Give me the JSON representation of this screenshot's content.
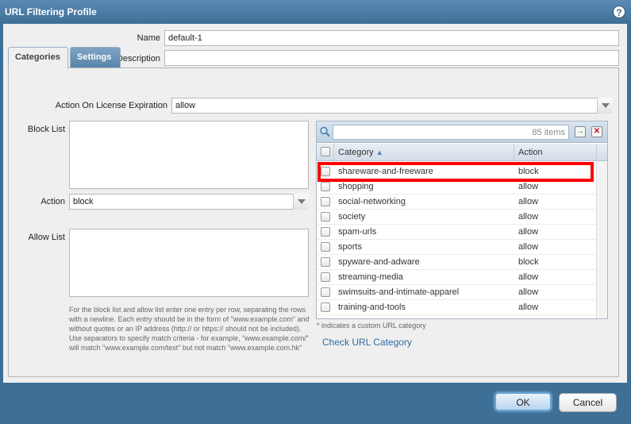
{
  "dialog": {
    "title": "URL Filtering Profile",
    "help_icon": "question-circle-icon",
    "help_glyph": "?"
  },
  "form": {
    "name_label": "Name",
    "name_value": "default-1",
    "description_label": "Description",
    "description_value": ""
  },
  "tabs": [
    {
      "label": "Categories",
      "active": true
    },
    {
      "label": "Settings",
      "active": false
    }
  ],
  "categories": {
    "license_label": "Action On License Expiration",
    "license_value": "allow",
    "block_list_label": "Block List",
    "action_label": "Action",
    "action_value": "block",
    "allow_list_label": "Allow List",
    "help_text": "For the block list and allow list enter one entry per row, separating the rows with a newline. Each entry should be in the form of \"www.example.com\" and without quotes or an IP address (http:// or https:// should not be included). Use separators to specify match criteria - for example, \"www.example.com/\" will match \"www.example.com/test\" but not match \"www.example.com.hk\"",
    "items_count": "85 items",
    "column_category": "Category",
    "sort_arrow": "▲",
    "column_action": "Action",
    "apply_glyph": "→",
    "clear_glyph": "✕",
    "rows": [
      {
        "category": "shareware-and-freeware",
        "action": "block"
      },
      {
        "category": "shopping",
        "action": "allow"
      },
      {
        "category": "social-networking",
        "action": "allow"
      },
      {
        "category": "society",
        "action": "allow"
      },
      {
        "category": "spam-urls",
        "action": "allow"
      },
      {
        "category": "sports",
        "action": "allow"
      },
      {
        "category": "spyware-and-adware",
        "action": "block"
      },
      {
        "category": "streaming-media",
        "action": "allow"
      },
      {
        "category": "swimsuits-and-intimate-apparel",
        "action": "allow"
      },
      {
        "category": "training-and-tools",
        "action": "allow"
      }
    ],
    "custom_note": "* indicates a custom URL category",
    "check_link": "Check URL Category"
  },
  "footer": {
    "ok_label": "OK",
    "cancel_label": "Cancel"
  },
  "colors": {
    "title_bar": "#4a7ba5",
    "highlight": "#ff0000",
    "link": "#2f6aa6"
  }
}
